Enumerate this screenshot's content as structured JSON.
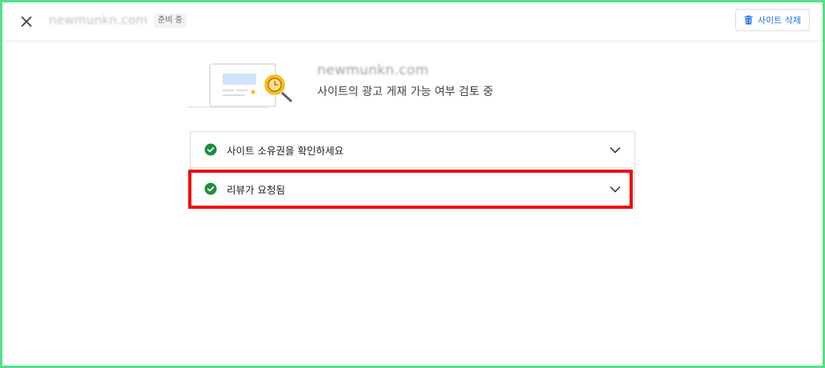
{
  "header": {
    "site_name": "newmunkn.com",
    "status_badge": "준비 중",
    "delete_label": "사이트 삭제"
  },
  "hero": {
    "site_name": "newmunkn.com",
    "status_text": "사이트의 광고 게재 가능 여부 검토 중"
  },
  "steps": [
    {
      "label": "사이트 소유권을 확인하세요",
      "done": true
    },
    {
      "label": "리뷰가 요청됨",
      "done": true
    }
  ],
  "colors": {
    "accent": "#1a73e8",
    "success": "#1e8e3e",
    "highlight": "#ee0d0d",
    "frame": "#4ee387"
  },
  "icons": {
    "close": "close-icon",
    "delete": "trash-icon",
    "check": "check-circle-icon",
    "expand": "chevron-down-icon"
  }
}
